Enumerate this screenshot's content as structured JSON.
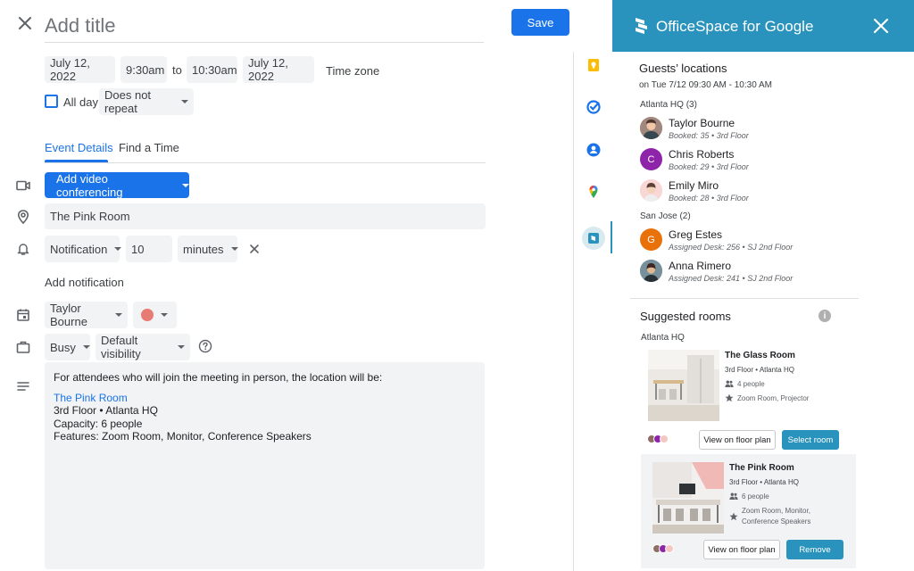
{
  "editor": {
    "title_placeholder": "Add title",
    "save_label": "Save",
    "start_date": "July 12, 2022",
    "start_time": "9:30am",
    "to_label": "to",
    "end_time": "10:30am",
    "end_date": "July 12, 2022",
    "timezone_label": "Time zone",
    "all_day_label": "All day",
    "repeat_value": "Does not repeat",
    "tabs": [
      {
        "label": "Event Details",
        "active": true
      },
      {
        "label": "Find a Time",
        "active": false
      }
    ],
    "video_conf_label": "Add video conferencing",
    "location_value": "The Pink Room",
    "notification_type": "Notification",
    "notification_amount": "10",
    "notification_unit": "minutes",
    "add_notification_label": "Add notification",
    "calendar_owner": "Taylor Bourne",
    "event_color": "#e67c73",
    "availability": "Busy",
    "visibility": "Default visibility",
    "description": {
      "intro": "For attendees who will join the meeting in person, the location will be:",
      "room_link": "The Pink Room",
      "floor": "3rd Floor • Atlanta HQ",
      "capacity": "Capacity: 6 people",
      "features": "Features: Zoom Room, Monitor, Conference Speakers"
    }
  },
  "panel": {
    "title": "OfficeSpace for Google",
    "guests_heading": "Guests’ locations",
    "guests_sub": "on Tue 7/12 09:30 AM - 10:30 AM",
    "groups": [
      {
        "label": "Atlanta HQ (3)",
        "guests": [
          {
            "name": "Taylor Bourne",
            "meta": "Booked: 35 • 3rd Floor",
            "initial": "",
            "color": "#8d6e63"
          },
          {
            "name": "Chris Roberts",
            "meta": "Booked: 29 • 3rd Floor",
            "initial": "C",
            "color": "#8e24aa"
          },
          {
            "name": "Emily Miro",
            "meta": "Booked: 28 • 3rd Floor",
            "initial": "",
            "color": "#f4c7c3"
          }
        ]
      },
      {
        "label": "San Jose (2)",
        "guests": [
          {
            "name": "Greg Estes",
            "meta": "Assigned Desk: 256 • SJ 2nd Floor",
            "initial": "G",
            "color": "#e8710a"
          },
          {
            "name": "Anna Rimero",
            "meta": "Assigned Desk: 241 • SJ 2nd Floor",
            "initial": "",
            "color": "#5d7c8a"
          }
        ]
      }
    ],
    "rooms_heading": "Suggested rooms",
    "rooms_location": "Atlanta HQ",
    "rooms": [
      {
        "name": "The Glass Room",
        "floor": "3rd Floor • Atlanta HQ",
        "capacity": "4 people",
        "features": "Zoom Room, Projector",
        "floor_plan_label": "View on floor plan",
        "action_label": "Select room"
      },
      {
        "name": "The Pink Room",
        "floor": "3rd Floor • Atlanta HQ",
        "capacity": "6 people",
        "features_line1": "Zoom Room, Monitor,",
        "features_line2": "Conference Speakers",
        "floor_plan_label": "View on floor plan",
        "action_label": "Remove"
      }
    ]
  },
  "colors": {
    "primary": "#1a73e8",
    "brand_teal": "#2a93bd"
  }
}
